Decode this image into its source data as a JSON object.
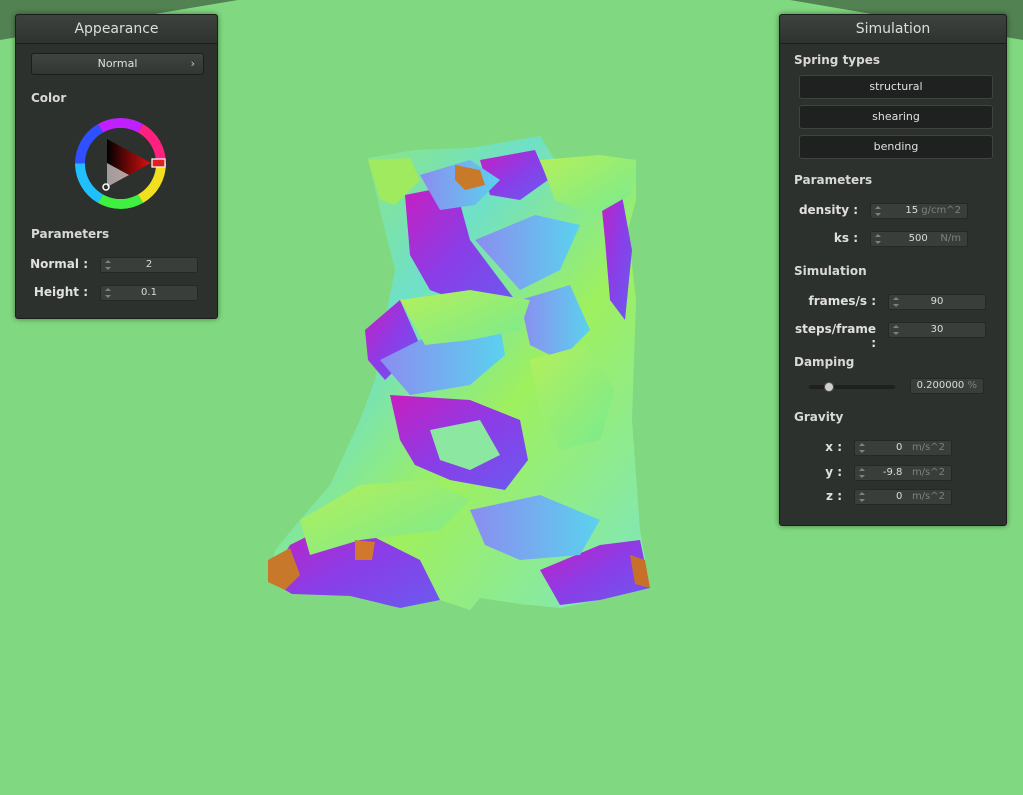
{
  "appearance": {
    "title": "Appearance",
    "shader_value": "Normal",
    "color_label": "Color",
    "parameters_label": "Parameters",
    "fields": [
      {
        "label": "Normal :",
        "value": "2"
      },
      {
        "label": "Height :",
        "value": "0.1"
      }
    ],
    "selected_color": "#ff0000"
  },
  "simulation": {
    "title": "Simulation",
    "spring_types_label": "Spring types",
    "spring_buttons": [
      "structural",
      "shearing",
      "bending"
    ],
    "parameters_label": "Parameters",
    "density": {
      "label": "density :",
      "value": "15",
      "unit": "g/cm^2"
    },
    "ks": {
      "label": "ks :",
      "value": "500",
      "unit": "N/m"
    },
    "simulation_label": "Simulation",
    "frames": {
      "label": "frames/s :",
      "value": "90"
    },
    "steps": {
      "label": "steps/frame :",
      "value": "30"
    },
    "damping_label": "Damping",
    "damping": {
      "value": "0.200000",
      "unit": "%",
      "slider_fraction": 0.2
    },
    "gravity_label": "Gravity",
    "gravity": [
      {
        "label": "x :",
        "value": "0",
        "unit": "m/s^2"
      },
      {
        "label": "y :",
        "value": "-9.8",
        "unit": "m/s^2"
      },
      {
        "label": "z :",
        "value": "0",
        "unit": "m/s^2"
      }
    ]
  },
  "scene": {
    "background_color": "#80d980",
    "cloth_palette": [
      "#a6f05a",
      "#7cf07c",
      "#5ad2ee",
      "#8c6cf0",
      "#b41ec8",
      "#d2329b",
      "#c8781e"
    ]
  }
}
